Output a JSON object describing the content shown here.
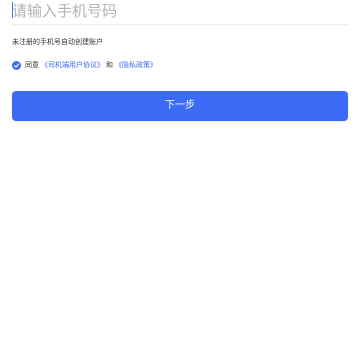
{
  "phone_input": {
    "value": "",
    "placeholder": "请输入手机号码"
  },
  "hint": "未注册的手机号自动创建账户",
  "agreement": {
    "checked": true,
    "prefix": "同意",
    "driver_agreement_link": "《司机端用户协议》",
    "conjunction": "和",
    "privacy_policy_link": "《隐私政策》"
  },
  "next_button": {
    "label": "下一步"
  },
  "colors": {
    "accent": "#3a6cf3",
    "button_bg": "#3c6cf6",
    "placeholder": "#b3b3b3"
  }
}
